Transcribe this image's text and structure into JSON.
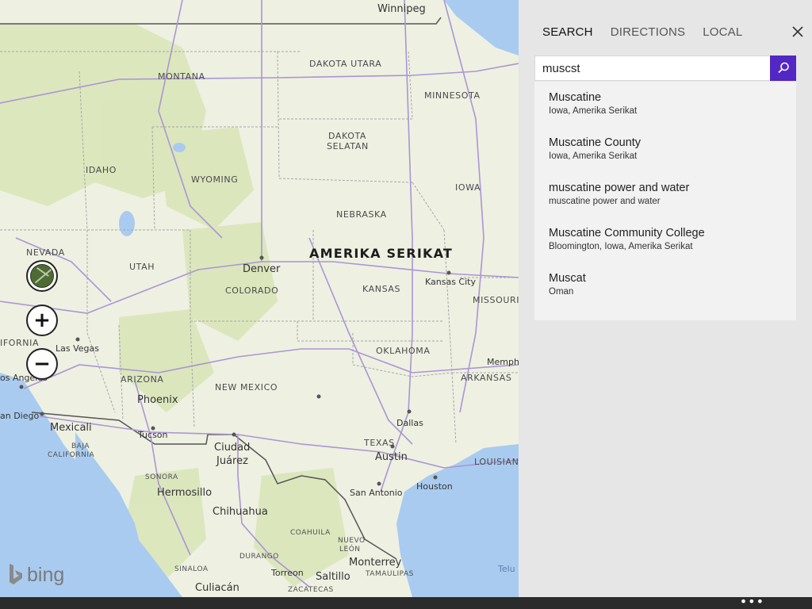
{
  "map": {
    "country_label": "AMERIKA SERIKAT",
    "states": [
      "MONTANA",
      "DAKOTA UTARA",
      "MINNESOTA",
      "DAKOTA",
      "SELATAN",
      "IDAHO",
      "WYOMING",
      "IOWA",
      "NEBRASKA",
      "NEVADA",
      "UTAH",
      "COLORADO",
      "KANSAS",
      "MISSOURI",
      "IFORNIA",
      "ARIZONA",
      "NEW MEXICO",
      "OKLAHOMA",
      "ARKANSAS",
      "TEXAS",
      "LOUISIAN",
      "BAJA",
      "CALIFORNIA",
      "SONORA",
      "COAHUILA",
      "NUEVO",
      "LEÓN",
      "DURANGO",
      "SINALOA",
      "ZACATECAS",
      "TAMAULIPAS"
    ],
    "cities": [
      "Winnipeg",
      "Denver",
      "Kansas City",
      "Las Vegas",
      "os Angeles",
      "Phoenix",
      "an Diego",
      "Mexicali",
      "Tucson",
      "Ciudad",
      "Juárez",
      "Dallas",
      "Austin",
      "Memph",
      "Hermosillo",
      "Chihuahua",
      "San Antonio",
      "Houston",
      "Monterrey",
      "Torreon",
      "Saltillo",
      "Culiacán",
      "Telu"
    ],
    "controls": {
      "zoom_in_symbol": "+",
      "zoom_out_symbol": "−"
    },
    "logo_text": "bing",
    "colors": {
      "land": "#eef0e2",
      "water": "#a9cbef",
      "road": "#b9a7d8",
      "highway": "#9f8cc9",
      "green": "#d6e3b5"
    }
  },
  "panel": {
    "tabs": [
      {
        "label": "SEARCH",
        "active": true
      },
      {
        "label": "DIRECTIONS",
        "active": false
      },
      {
        "label": "LOCAL",
        "active": false
      }
    ],
    "search": {
      "value": "muscst"
    },
    "results": [
      {
        "title": "Muscatine",
        "subtitle": "Iowa, Amerika Serikat"
      },
      {
        "title": "Muscatine County",
        "subtitle": "Iowa, Amerika Serikat"
      },
      {
        "title": "muscatine power and water",
        "subtitle": "muscatine power and water"
      },
      {
        "title": "Muscatine Community College",
        "subtitle": "Bloomington, Iowa, Amerika Serikat"
      },
      {
        "title": "Muscat",
        "subtitle": "Oman"
      }
    ],
    "accent_color": "#5227c4"
  },
  "appbar": {
    "more_label": "•••"
  }
}
